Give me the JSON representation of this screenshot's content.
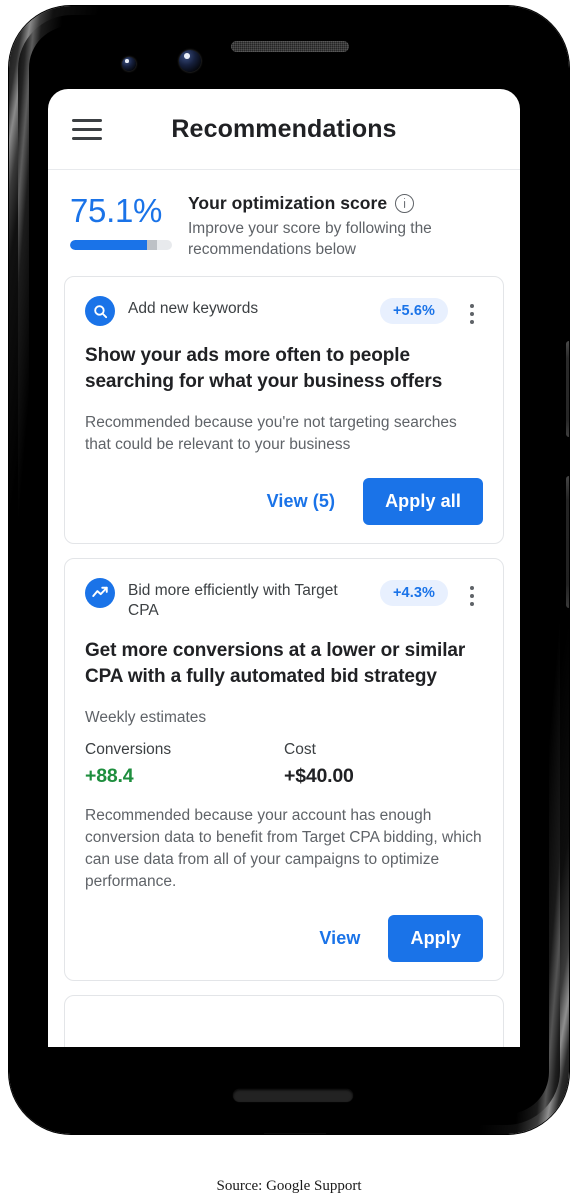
{
  "caption": "Source: Google Support",
  "app": {
    "bar": {
      "menu_icon": "hamburger-menu-icon",
      "title": "Recommendations"
    },
    "optimization_score": {
      "value": "75.1%",
      "progress_percent": 75.1,
      "progress_shadow_percent": 10,
      "heading": "Your optimization score",
      "info_icon": "info-circle-icon",
      "subtext": "Improve your score by following the recommendations below",
      "accent_color": "#1a73e8",
      "track_color": "#e8eaed",
      "shadow_color": "#bdc1c6"
    },
    "recommendations": [
      {
        "icon": "search-magnifier-icon",
        "label": "Add new keywords",
        "score_uplift": "+5.6%",
        "overflow_icon": "more-vertical-icon",
        "title": "Show your ads more often to people searching for what your business offers",
        "reason": "Recommended because you're not targeting searches that could be relevant to your business",
        "estimates_label": "",
        "metrics": [],
        "secondary_action": "View (5)",
        "primary_action": "Apply all"
      },
      {
        "icon": "trending-up-icon",
        "label": "Bid more efficiently with Target CPA",
        "score_uplift": "+4.3%",
        "overflow_icon": "more-vertical-icon",
        "title": "Get more conversions at a lower or similar CPA with a fully automated bid strategy",
        "estimates_label": "Weekly estimates",
        "metrics": [
          {
            "name": "Conversions",
            "value": "+88.4",
            "tone": "positive"
          },
          {
            "name": "Cost",
            "value": "+$40.00",
            "tone": "neutral"
          }
        ],
        "reason": "Recommended because your account has enough conversion data to benefit from Target CPA bidding, which can use data from all of your campaigns to optimize performance.",
        "secondary_action": "View",
        "primary_action": "Apply"
      }
    ],
    "colors": {
      "brand_blue": "#1a73e8",
      "badge_bg": "#e8f0fe",
      "positive_green": "#1e8e3e",
      "text_primary": "#202124",
      "text_secondary": "#5f6368",
      "card_border": "#e3e5e8"
    }
  },
  "device": {
    "earpiece": "earpiece-speaker",
    "front_camera": "front-camera",
    "power_button": "power-button",
    "volume_button": "volume-button"
  }
}
